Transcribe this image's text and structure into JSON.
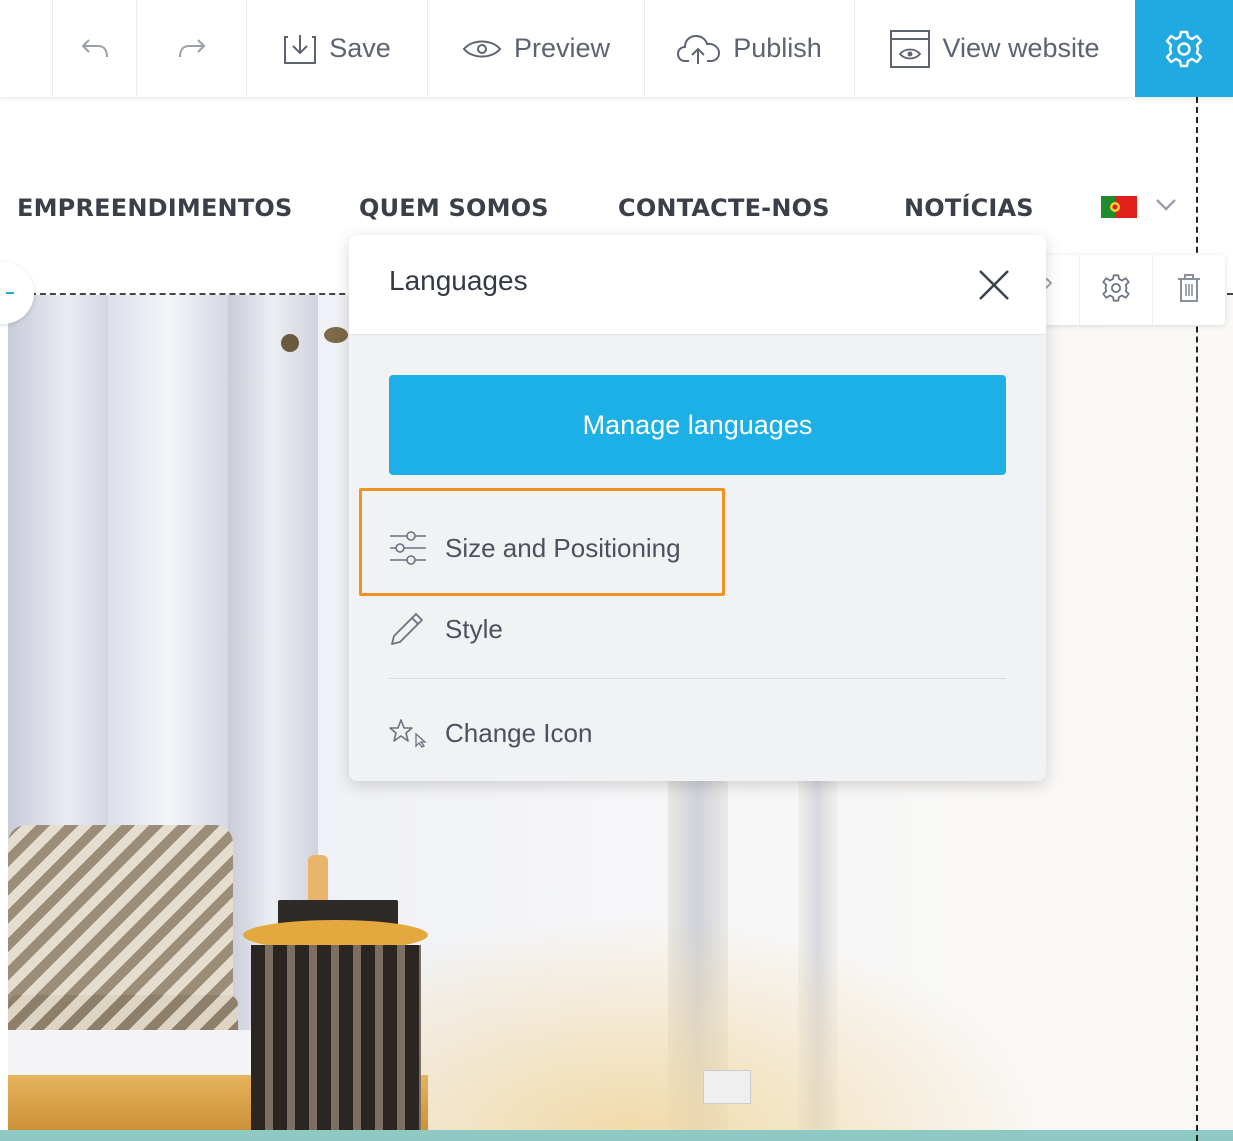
{
  "toolbar": {
    "undo_icon": "undo-icon",
    "redo_icon": "redo-icon",
    "save_label": "Save",
    "preview_label": "Preview",
    "publish_label": "Publish",
    "view_website_label": "View website",
    "settings_icon": "gear-icon",
    "accent_color": "#21a9e1"
  },
  "site_nav": {
    "items": [
      "EMPREENDIMENTOS",
      "QUEM SOMOS",
      "CONTACTE-NOS",
      "NOTÍCIAS"
    ],
    "language_flag": "portugal-flag-icon"
  },
  "element_toolbar": {
    "icons": [
      "edit-icon",
      "gear-icon",
      "trash-icon"
    ]
  },
  "languages_popup": {
    "title": "Languages",
    "close_icon": "close-icon",
    "manage_button": "Manage languages",
    "items": [
      {
        "label": "Size and Positioning",
        "icon": "sliders-icon",
        "highlighted": true
      },
      {
        "label": "Style",
        "icon": "pencil-icon"
      },
      {
        "label": "Change Icon",
        "icon": "star-cursor-icon"
      }
    ],
    "highlight_color": "#f0921f",
    "button_color": "#1db0e6"
  }
}
